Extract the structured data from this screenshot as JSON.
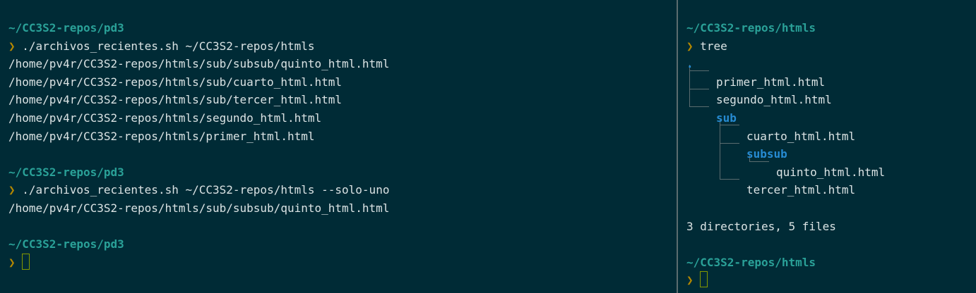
{
  "left_pane": {
    "blocks": [
      {
        "cwd": "~/CC3S2-repos/pd3",
        "prompt": "❯",
        "command": "./archivos_recientes.sh ~/CC3S2-repos/htmls",
        "output": [
          "/home/pv4r/CC3S2-repos/htmls/sub/subsub/quinto_html.html",
          "/home/pv4r/CC3S2-repos/htmls/sub/cuarto_html.html",
          "/home/pv4r/CC3S2-repos/htmls/sub/tercer_html.html",
          "/home/pv4r/CC3S2-repos/htmls/segundo_html.html",
          "/home/pv4r/CC3S2-repos/htmls/primer_html.html"
        ]
      },
      {
        "cwd": "~/CC3S2-repos/pd3",
        "prompt": "❯",
        "command": "./archivos_recientes.sh ~/CC3S2-repos/htmls --solo-uno",
        "output": [
          "/home/pv4r/CC3S2-repos/htmls/sub/subsub/quinto_html.html"
        ]
      },
      {
        "cwd": "~/CC3S2-repos/pd3",
        "prompt": "❯"
      }
    ]
  },
  "right_pane": {
    "cwd": "~/CC3S2-repos/htmls",
    "prompt": "❯",
    "command": "tree",
    "tree": {
      "root": ".",
      "primer": "primer_html.html",
      "segundo": "segundo_html.html",
      "sub": "sub",
      "cuarto": "cuarto_html.html",
      "subsub": "subsub",
      "quinto": "quinto_html.html",
      "tercer": "tercer_html.html"
    },
    "summary": "3 directories, 5 files",
    "cwd2": "~/CC3S2-repos/htmls",
    "prompt2": "❯"
  },
  "colors": {
    "background": "#002b36",
    "path": "#2aa198",
    "prompt": "#b58900",
    "directory": "#268bd2",
    "text": "#dbe3e4",
    "cursor": "#859900"
  },
  "icons": {
    "prompt": "chevron-right-icon",
    "cursor": "block-cursor-icon"
  }
}
